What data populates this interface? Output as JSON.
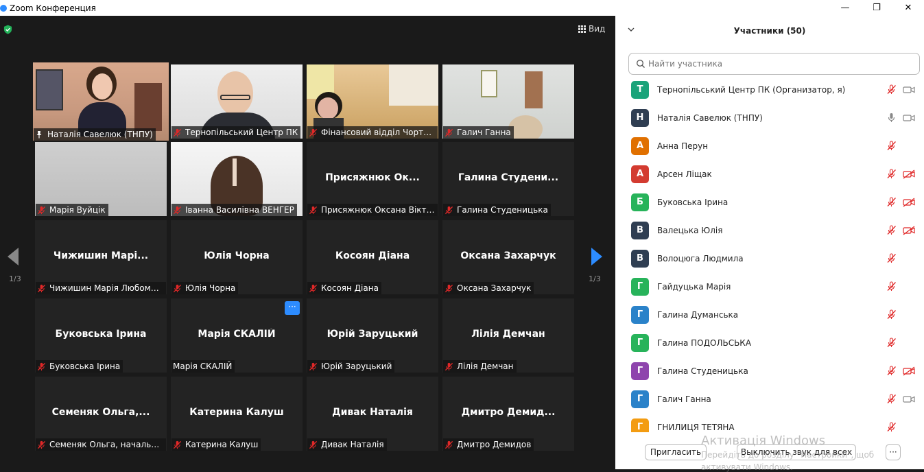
{
  "window": {
    "title": "Zoom Конференция",
    "controls": [
      "—",
      "❐",
      "✕"
    ]
  },
  "toolbar": {
    "view_label": "Вид"
  },
  "pagination": {
    "left": "1/3",
    "right": "1/3"
  },
  "tiles": [
    {
      "bigname": "",
      "label": "Наталія Савелюк (ТНПУ)",
      "icon": "pin",
      "active": true,
      "photo": "woman-office"
    },
    {
      "bigname": "",
      "label": "Тернопільський Центр ПК",
      "icon": "mute",
      "photo": "man-glasses"
    },
    {
      "bigname": "",
      "label": "Фінансовий відділ Чортків...",
      "icon": "mute",
      "photo": "woman-office2"
    },
    {
      "bigname": "",
      "label": "Галич Ганна",
      "icon": "mute",
      "photo": "room-wall"
    },
    {
      "bigname": "",
      "label": "Марія Вуйцік",
      "icon": "mute",
      "photo": "grey-wall"
    },
    {
      "bigname": "",
      "label": "Іванна Василівна ВЕНГЕР",
      "icon": "mute",
      "photo": "woman-head"
    },
    {
      "bigname": "Присяжнюк  Ок...",
      "label": "Присяжнюк Оксана Віктор...",
      "icon": "mute"
    },
    {
      "bigname": "Галина  Студени...",
      "label": "Галина Студеницька",
      "icon": "mute"
    },
    {
      "bigname": "Чижишин  Марі...",
      "label": "Чижишин Марія Любоми...",
      "icon": "mute"
    },
    {
      "bigname": "Юлія Чорна",
      "label": "Юлія Чорна",
      "icon": "mute"
    },
    {
      "bigname": "Косоян Діана",
      "label": "Косоян Діана",
      "icon": "mute"
    },
    {
      "bigname": "Оксана Захарчук",
      "label": "Оксана Захарчук",
      "icon": "mute"
    },
    {
      "bigname": "Буковська Ірина",
      "label": "Буковська Ірина",
      "icon": "mute"
    },
    {
      "bigname": "Марія СКАЛІЙ",
      "label": "Марія СКАЛІЙ",
      "icon": "none",
      "more": "···"
    },
    {
      "bigname": "Юрій Заруцький",
      "label": "Юрій Заруцький",
      "icon": "mute"
    },
    {
      "bigname": "Лілія Демчан",
      "label": "Лілія Демчан",
      "icon": "mute"
    },
    {
      "bigname": "Семеняк  Ольга,...",
      "label": "Семеняк Ольга, начальни...",
      "icon": "mute"
    },
    {
      "bigname": "Катерина Калуш",
      "label": "Катерина Калуш",
      "icon": "mute"
    },
    {
      "bigname": "Дивак Наталія",
      "label": "Дивак Наталія",
      "icon": "mute"
    },
    {
      "bigname": "Дмитро  Демид...",
      "label": "Дмитро Демидов",
      "icon": "mute"
    }
  ],
  "panel": {
    "title": "Участники (50)",
    "search_placeholder": "Найти участника",
    "participants": [
      {
        "initial": "Т",
        "name": "Тернопільський Центр ПК (Организатор, я)",
        "color": "#1aa37a",
        "mic": "muted",
        "cam": "on"
      },
      {
        "initial": "Н",
        "name": "Наталія Савелюк (ТНПУ)",
        "color": "#2f3e52",
        "mic": "on",
        "cam": "on"
      },
      {
        "initial": "А",
        "name": "Анна Перун",
        "color": "#e07000",
        "mic": "muted",
        "cam": "none"
      },
      {
        "initial": "А",
        "name": "Арсен Ліщак",
        "color": "#d33b30",
        "mic": "muted",
        "cam": "off"
      },
      {
        "initial": "Б",
        "name": "Буковська Ірина",
        "color": "#27b35a",
        "mic": "muted",
        "cam": "off"
      },
      {
        "initial": "В",
        "name": "Валецька Юлія",
        "color": "#2f3e52",
        "mic": "muted",
        "cam": "off"
      },
      {
        "initial": "В",
        "name": "Волоцюга Людмила",
        "color": "#2f3e52",
        "mic": "muted",
        "cam": "none"
      },
      {
        "initial": "Г",
        "name": "Гайдуцька Марія",
        "color": "#27b35a",
        "mic": "muted",
        "cam": "none"
      },
      {
        "initial": "Г",
        "name": "Галина Думанська",
        "color": "#2a82c9",
        "mic": "muted",
        "cam": "none"
      },
      {
        "initial": "Г",
        "name": "Галина ПОДОЛЬСЬКА",
        "color": "#27b35a",
        "mic": "muted",
        "cam": "none"
      },
      {
        "initial": "Г",
        "name": "Галина Студеницька",
        "color": "#8e44ad",
        "mic": "muted",
        "cam": "off"
      },
      {
        "initial": "Г",
        "name": "Галич Ганна",
        "color": "#2a82c9",
        "mic": "muted",
        "cam": "on"
      },
      {
        "initial": "Г",
        "name": "ГНИЛИЦЯ ТЕТЯНА",
        "color": "#f39c12",
        "mic": "muted",
        "cam": "none"
      }
    ],
    "invite_label": "Пригласить",
    "mute_all_label": "Выключить звук для всех",
    "more_label": "···"
  },
  "watermark": {
    "line1": "Активація Windows",
    "line2": "Перейдіть до розділу \"Настройки\", щоб",
    "line3": "активувати Windows."
  }
}
